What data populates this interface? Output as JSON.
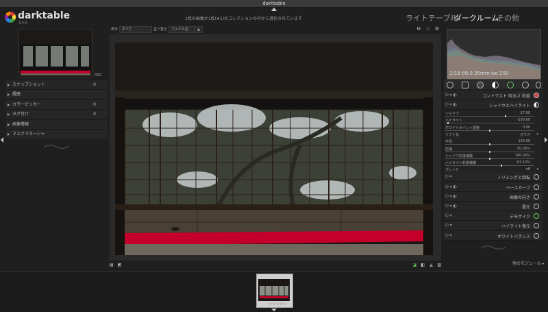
{
  "window": {
    "title": "darktable"
  },
  "app": {
    "name": "darktable",
    "version": "3.4.0"
  },
  "header": {
    "collection_info": "1枚の画像が1枚(#1)のコレクションの中から選択されています",
    "views": {
      "lighttable": "ライトテーブル",
      "darkroom": "ダークルーム",
      "other": "その他",
      "sep": "|"
    }
  },
  "left_panel": {
    "modules": [
      {
        "label": "スナップショット",
        "badge": "0"
      },
      {
        "label": "履歴",
        "badge": ""
      },
      {
        "label": "カラーピッカー",
        "badge": "0"
      },
      {
        "label": "タグ付け",
        "badge": "0"
      },
      {
        "label": "画像情報",
        "badge": ""
      },
      {
        "label": "マスクマネージャ",
        "badge": ""
      }
    ]
  },
  "toolbar": {
    "filter_label": "表示",
    "filter_value": "すべて",
    "sort_label": "並べ替え",
    "sort_value": "ファイル名"
  },
  "histogram": {
    "info": "1/18 f/8.0 35mm iso 200"
  },
  "right_panel": {
    "modules_top": [
      {
        "label": "コントラスト 明るさ 彩度"
      },
      {
        "label": "シャドウとハイライト"
      }
    ],
    "shadows_highlights": {
      "params": [
        {
          "label": "シャドウ",
          "value": "27.60",
          "pos": 0.68
        },
        {
          "label": "ハイライト",
          "value": "-100.00",
          "pos": 0.02
        },
        {
          "label": "ホワイトポイント調整",
          "value": "0.00",
          "pos": 0.5
        },
        {
          "label": "ソフト化",
          "value": "ガウス",
          "pos": null
        },
        {
          "label": "半径",
          "value": "100.00",
          "pos": 0.5
        },
        {
          "label": "圧縮",
          "value": "50.00%",
          "pos": 0.5
        },
        {
          "label": "シャドウ彩度補償",
          "value": "100.00%",
          "pos": 0.5
        },
        {
          "label": "ハイライト彩度補償",
          "value": "63.12%",
          "pos": 0.63
        },
        {
          "label": "ブレンド",
          "value": "off",
          "pos": null
        }
      ]
    },
    "modules_bottom": [
      {
        "label": "トリミングと回転"
      },
      {
        "label": "ベースカーブ"
      },
      {
        "label": "画像の向き"
      },
      {
        "label": "露光"
      },
      {
        "label": "デモザイク"
      },
      {
        "label": "ハイライト復元"
      },
      {
        "label": "ホワイトバランス"
      }
    ],
    "more_modules": "他のモジュール"
  },
  "colors": {
    "accent": "#e0e0e0",
    "carpet": "#c4002a",
    "panel": "#262626"
  }
}
